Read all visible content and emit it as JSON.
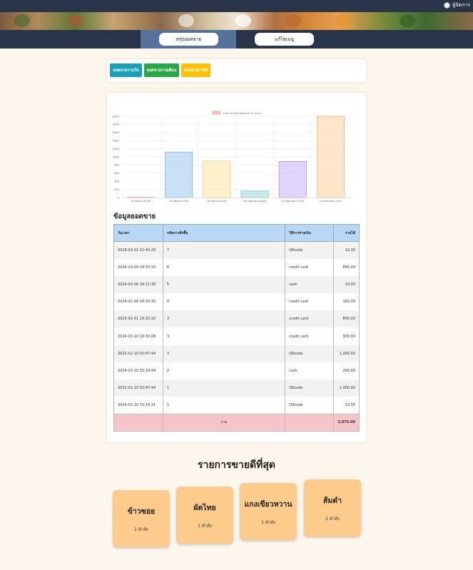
{
  "header": {
    "admin_label": "ผู้จัดการ"
  },
  "nav": {
    "items": [
      {
        "label": "สรุปยอดขาย"
      },
      {
        "label": "แก้ไขเมนู"
      }
    ]
  },
  "filters": [
    {
      "label": "ยอดขายรายวัน",
      "color": "#17a2b8"
    },
    {
      "label": "ยอดขายรายเดือน",
      "color": "#28a745"
    },
    {
      "label": "ยอดขายรายปี",
      "color": "#ffc107"
    }
  ],
  "chart_data": {
    "type": "bar",
    "legend": "รายการขายได้ ยอดขายรวม (บาท)",
    "categories": [
      "01-March-2026",
      "10-March-2024",
      "06-March-2024",
      "04-February-2024",
      "01-February-2023",
      "10-February-2022"
    ],
    "values": [
      10,
      1120,
      900,
      160,
      890,
      2000
    ],
    "y_ticks": [
      "2000",
      "1800",
      "1600",
      "1400",
      "1200",
      "1000",
      "800",
      "600",
      "400",
      "200",
      "0"
    ],
    "ylim": [
      0,
      2000
    ],
    "colors": [
      "#f7c2cc",
      "#9cc8f1",
      "#ffe3a3",
      "#9ed8d8",
      "#c9b0ff",
      "#ffcf9c"
    ],
    "borders": [
      "#f08a9c",
      "#5da3e0",
      "#f0c060",
      "#5ab8b8",
      "#9a76f0",
      "#f0a060"
    ]
  },
  "sales": {
    "title": "ข้อมูลยอดขาย",
    "columns": [
      "วันเวลา",
      "รหัสการสั่งซื้อ",
      "วิธีการจ่ายเงิน",
      "รายได้"
    ],
    "rows": [
      [
        "2026-03-01 02:45:29",
        "7",
        "QRcode",
        "10.00"
      ],
      [
        "2024-03-09 18:15:10",
        "6",
        "credit card",
        "890.00"
      ],
      [
        "2024-03-06 18:11:30",
        "5",
        "cash",
        "10.00"
      ],
      [
        "2024-02-04 18:10:35",
        "4",
        "credit card",
        "160.00"
      ],
      [
        "2023-02-01 18:15:10",
        "3",
        "credit card",
        "890.00"
      ],
      [
        "2024-03-10 18:30:08",
        "3",
        "credit card",
        "900.00"
      ],
      [
        "2022-02-10 02:47:44",
        "3",
        "QRcode",
        "1,000.00"
      ],
      [
        "2024-03-10 15:14:49",
        "2",
        "cash",
        "200.00"
      ],
      [
        "2022-02-10 02:47:44",
        "1",
        "QRcode",
        "1,000.00"
      ],
      [
        "2024-03-10 15:14:31",
        "1",
        "QRcode",
        "10.00"
      ]
    ],
    "total_label": "รวม",
    "total_value": "5,070.00"
  },
  "best": {
    "title": "รายการขายดีที่สุด",
    "items": [
      {
        "name": "ข้าวซอย",
        "count": "1 คำสั่ง"
      },
      {
        "name": "ผัดไทย",
        "count": "1 คำสั่ง"
      },
      {
        "name": "แกงเขียวหวาน",
        "count": "1 คำสั่ง"
      },
      {
        "name": "ส้มตำ",
        "count": "2 คำสั่ง"
      }
    ]
  }
}
